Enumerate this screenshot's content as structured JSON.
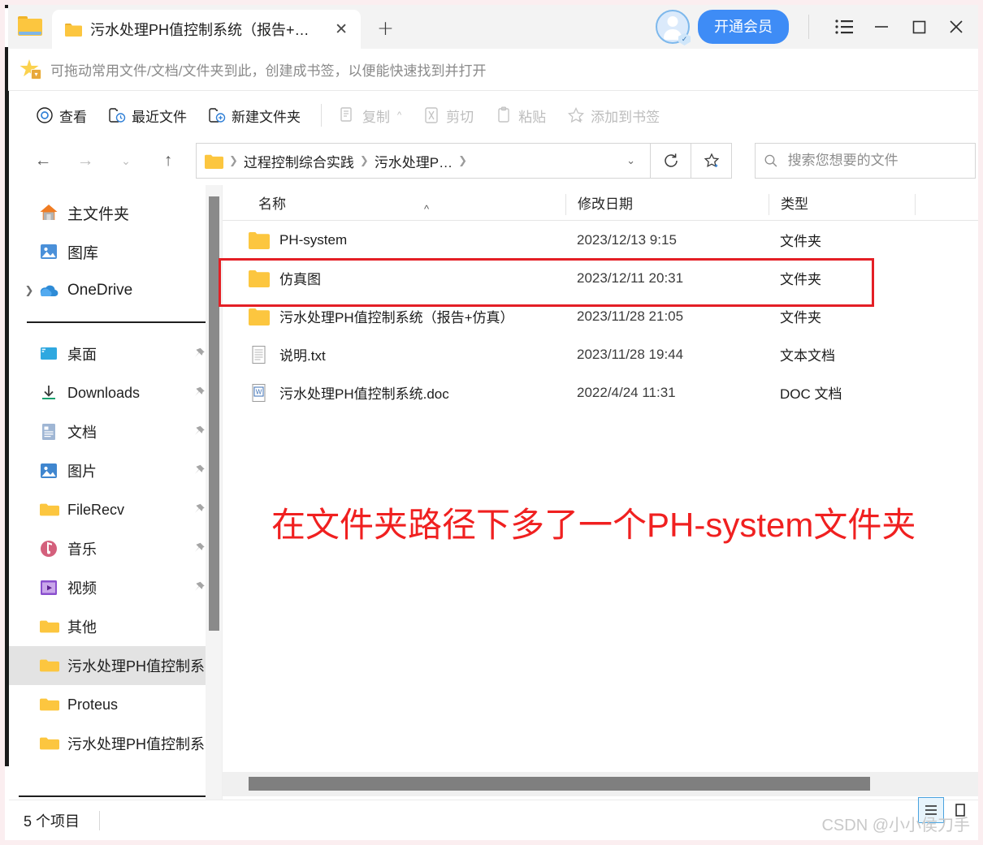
{
  "window": {
    "title_bar": {
      "app_icon": "folder-icon",
      "tab": {
        "icon": "folder-icon",
        "title": "污水处理PH值控制系统（报告+仿…",
        "close": "✕"
      },
      "new_tab": "+",
      "vip_button": "开通会员",
      "menu_icon": "list-menu-icon",
      "minimize": "minimize-icon",
      "maximize": "maximize-icon",
      "close": "close-icon"
    },
    "bookmark_bar": {
      "icon": "star-bookmark-icon",
      "hint": "可拖动常用文件/文档/文件夹到此，创建成书签，以便能快速找到并打开"
    }
  },
  "toolbar": {
    "items": [
      {
        "label": "查看",
        "icon": "eye-icon",
        "disabled": false
      },
      {
        "label": "最近文件",
        "icon": "recent-file-icon",
        "disabled": false
      },
      {
        "label": "新建文件夹",
        "icon": "new-folder-icon",
        "disabled": false
      },
      {
        "label": "复制",
        "icon": "copy-icon",
        "disabled": true,
        "caret": "^"
      },
      {
        "label": "剪切",
        "icon": "cut-icon",
        "disabled": true
      },
      {
        "label": "粘贴",
        "icon": "paste-icon",
        "disabled": true
      },
      {
        "label": "添加到书签",
        "icon": "add-bookmark-icon",
        "disabled": true
      }
    ]
  },
  "address_bar": {
    "back": "←",
    "forward": "→",
    "history_dropdown": "⌄",
    "up": "↑",
    "folder_icon": "folder-icon",
    "breadcrumbs": [
      "过程控制综合实践",
      "污水处理P…"
    ],
    "path_dropdown": "⌄",
    "refresh": "refresh-icon",
    "add_bookmark": "star-plus-icon"
  },
  "search": {
    "icon": "search-icon",
    "placeholder": "搜索您想要的文件",
    "value": ""
  },
  "sidebar": {
    "groups": [
      {
        "items": [
          {
            "label": "主文件夹",
            "icon": "home-icon",
            "pin": false,
            "expander": false,
            "active": false
          },
          {
            "label": "图库",
            "icon": "gallery-icon",
            "pin": false,
            "expander": false,
            "active": false
          },
          {
            "label": "OneDrive",
            "icon": "onedrive-cloud-icon",
            "pin": false,
            "expander": true,
            "active": false
          }
        ]
      },
      {
        "items": [
          {
            "label": "桌面",
            "icon": "desktop-icon",
            "pin": true,
            "expander": false,
            "active": false
          },
          {
            "label": "Downloads",
            "icon": "downloads-icon",
            "pin": true,
            "expander": false,
            "active": false
          },
          {
            "label": "文档",
            "icon": "documents-icon",
            "pin": true,
            "expander": false,
            "active": false
          },
          {
            "label": "图片",
            "icon": "pictures-icon",
            "pin": true,
            "expander": false,
            "active": false
          },
          {
            "label": "FileRecv",
            "icon": "folder-icon",
            "pin": true,
            "expander": false,
            "active": false
          },
          {
            "label": "音乐",
            "icon": "music-icon",
            "pin": true,
            "expander": false,
            "active": false
          },
          {
            "label": "视频",
            "icon": "video-icon",
            "pin": true,
            "expander": false,
            "active": false
          },
          {
            "label": "其他",
            "icon": "folder-icon",
            "pin": false,
            "expander": false,
            "active": false
          },
          {
            "label": "污水处理PH值控制系",
            "icon": "folder-icon",
            "pin": false,
            "expander": false,
            "active": true
          },
          {
            "label": "Proteus",
            "icon": "folder-icon",
            "pin": false,
            "expander": false,
            "active": false
          },
          {
            "label": "污水处理PH值控制系",
            "icon": "folder-icon",
            "pin": false,
            "expander": false,
            "active": false
          }
        ]
      }
    ]
  },
  "file_list": {
    "columns": [
      {
        "key": "name",
        "label": "名称",
        "sorted": true,
        "sort_arrow": "^"
      },
      {
        "key": "date",
        "label": "修改日期"
      },
      {
        "key": "type",
        "label": "类型"
      }
    ],
    "rows": [
      {
        "name": "PH-system",
        "date": "2023/12/13 9:15",
        "type": "文件夹",
        "icon": "folder-icon",
        "highlighted": true
      },
      {
        "name": "仿真图",
        "date": "2023/12/11 20:31",
        "type": "文件夹",
        "icon": "folder-icon",
        "highlighted": false
      },
      {
        "name": "污水处理PH值控制系统（报告+仿真）",
        "date": "2023/11/28 21:05",
        "type": "文件夹",
        "icon": "folder-icon",
        "highlighted": false
      },
      {
        "name": "说明.txt",
        "date": "2023/11/28 19:44",
        "type": "文本文档",
        "icon": "text-file-icon",
        "highlighted": false
      },
      {
        "name": "污水处理PH值控制系统.doc",
        "date": "2022/4/24 11:31",
        "type": "DOC 文档",
        "icon": "word-file-icon",
        "highlighted": false
      }
    ],
    "annotation": "在文件夹路径下多了一个PH-system文件夹"
  },
  "status_bar": {
    "item_count": "5 个项目",
    "view_list_icon": "list-view-icon",
    "view_tile_icon": "tile-view-icon"
  },
  "watermark": "CSDN @小小侯刀手",
  "colors": {
    "accent_blue": "#3e8cf6",
    "annotation_red": "#f02020",
    "highlight_red": "#e41f25",
    "folder_yellow": "#fcc63f",
    "selected_row": "#e3e3e3"
  }
}
